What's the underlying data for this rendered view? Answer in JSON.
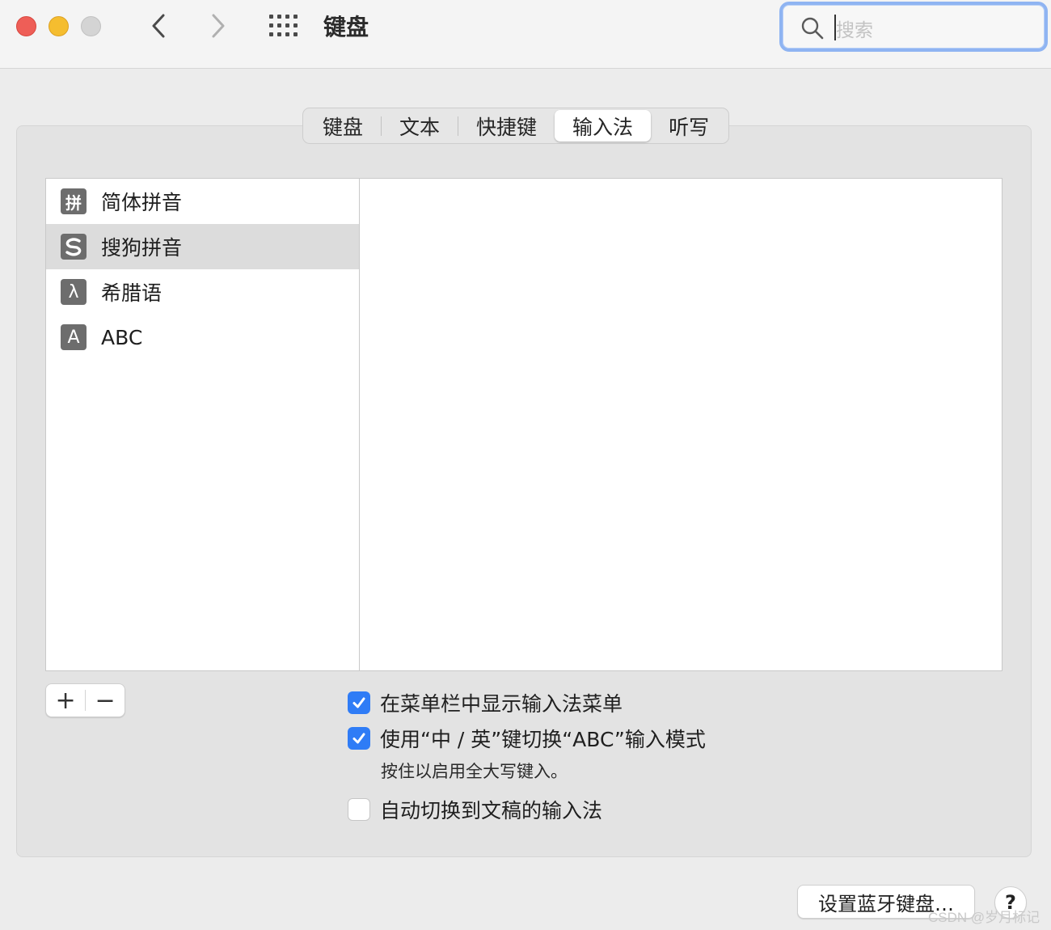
{
  "window": {
    "title": "键盘",
    "controls": [
      "close",
      "minimize",
      "zoom"
    ]
  },
  "toolbar": {
    "back_icon": "chevron-left-icon",
    "forward_icon": "chevron-right-icon",
    "grid_icon": "grid-icon"
  },
  "search": {
    "placeholder": "搜索",
    "value": ""
  },
  "tabs": [
    {
      "label": "键盘",
      "selected": false
    },
    {
      "label": "文本",
      "selected": false
    },
    {
      "label": "快捷键",
      "selected": false
    },
    {
      "label": "输入法",
      "selected": true
    },
    {
      "label": "听写",
      "selected": false
    }
  ],
  "input_sources": [
    {
      "icon_text": "拼",
      "label": "简体拼音",
      "selected": false
    },
    {
      "icon_text": "S",
      "label": "搜狗拼音",
      "selected": true
    },
    {
      "icon_text": "λ",
      "label": "希腊语",
      "selected": false
    },
    {
      "icon_text": "A",
      "label": "ABC",
      "selected": false
    }
  ],
  "list_controls": {
    "add": "+",
    "remove": "−"
  },
  "options": {
    "show_menu": {
      "label": "在菜单栏中显示输入法菜单",
      "checked": true
    },
    "caps_switch": {
      "label": "使用“中 / 英”键切换“ABC”输入模式",
      "checked": true,
      "note": "按住以启用全大写键入。"
    },
    "auto_switch": {
      "label": "自动切换到文稿的输入法",
      "checked": false
    }
  },
  "footer": {
    "bluetooth_button": "设置蓝牙键盘…",
    "help_button": "?"
  },
  "watermark": "CSDN @岁月标记",
  "colors": {
    "accent": "#2f7cf6",
    "search_focus": "#8fb4f2",
    "close": "#ee5e57",
    "minimize": "#f5bd2f",
    "zoom": "#d4d4d4"
  }
}
